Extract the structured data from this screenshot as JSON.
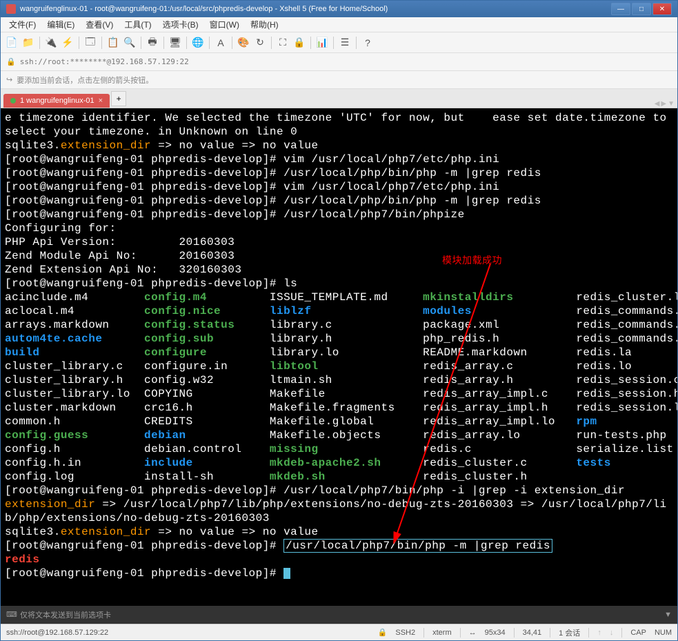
{
  "window_title": "wangruifenglinux-01 - root@wangruifeng-01:/usr/local/src/phpredis-develop - Xshell 5 (Free for Home/School)",
  "menu": {
    "file": "文件(F)",
    "edit": "编辑(E)",
    "view": "查看(V)",
    "tools": "工具(T)",
    "tabs": "选项卡(B)",
    "window": "窗口(W)",
    "help": "帮助(H)"
  },
  "addr": {
    "lock": "🔒",
    "text": "ssh://root:********@192.168.57.129:22"
  },
  "infobar_text": "要添加当前会话，点击左侧的箭头按钮。",
  "tab": {
    "label": "1 wangruifenglinux-01"
  },
  "annotation": "模块加载成功",
  "terminal": {
    "l1": "e timezone identifier. We selected the timezone 'UTC' for now, but    ease set date.timezone to",
    "l2": "select your timezone. in Unknown on line 0",
    "l3a": "sqlite3.",
    "l3b": "extension_dir",
    "l3c": " => no value => no value",
    "p1": "[root@wangruifeng-01 phpredis-develop]# ",
    "c1": "vim /usr/local/php7/etc/php.ini",
    "c2": "/usr/local/php/bin/php -m |grep redis",
    "c3": "vim /usr/local/php7/etc/php.ini",
    "c4": "/usr/local/php/bin/php -m |grep redis",
    "c5": "/usr/local/php7/bin/phpize",
    "cfg1": "Configuring for:",
    "cfg2": "PHP Api Version:         20160303",
    "cfg3": "Zend Module Api No:      20160303",
    "cfg4": "Zend Extension Api No:   320160303",
    "c6": "ls",
    "ls": [
      {
        "a": "acinclude.m4",
        "ac": "",
        "b": "config.m4",
        "bc": "green",
        "c": "ISSUE_TEMPLATE.md",
        "cc": "",
        "d": "mkinstalldirs",
        "dc": "green",
        "e": "redis_cluster.lo",
        "ec": ""
      },
      {
        "a": "aclocal.m4",
        "ac": "",
        "b": "config.nice",
        "bc": "green",
        "c": "liblzf",
        "cc": "blue",
        "d": "modules",
        "dc": "blue",
        "e": "redis_commands.c",
        "ec": ""
      },
      {
        "a": "arrays.markdown",
        "ac": "",
        "b": "config.status",
        "bc": "green",
        "c": "library.c",
        "cc": "",
        "d": "package.xml",
        "dc": "",
        "e": "redis_commands.h",
        "ec": ""
      },
      {
        "a": "autom4te.cache",
        "ac": "blue",
        "b": "config.sub",
        "bc": "green",
        "c": "library.h",
        "cc": "",
        "d": "php_redis.h",
        "dc": "",
        "e": "redis_commands.lo",
        "ec": ""
      },
      {
        "a": "build",
        "ac": "blue",
        "b": "configure",
        "bc": "green",
        "c": "library.lo",
        "cc": "",
        "d": "README.markdown",
        "dc": "",
        "e": "redis.la",
        "ec": ""
      },
      {
        "a": "cluster_library.c",
        "ac": "",
        "b": "configure.in",
        "bc": "",
        "c": "libtool",
        "cc": "green",
        "d": "redis_array.c",
        "dc": "",
        "e": "redis.lo",
        "ec": ""
      },
      {
        "a": "cluster_library.h",
        "ac": "",
        "b": "config.w32",
        "bc": "",
        "c": "ltmain.sh",
        "cc": "",
        "d": "redis_array.h",
        "dc": "",
        "e": "redis_session.c",
        "ec": ""
      },
      {
        "a": "cluster_library.lo",
        "ac": "",
        "b": "COPYING",
        "bc": "",
        "c": "Makefile",
        "cc": "",
        "d": "redis_array_impl.c",
        "dc": "",
        "e": "redis_session.h",
        "ec": ""
      },
      {
        "a": "cluster.markdown",
        "ac": "",
        "b": "crc16.h",
        "bc": "",
        "c": "Makefile.fragments",
        "cc": "",
        "d": "redis_array_impl.h",
        "dc": "",
        "e": "redis_session.lo",
        "ec": ""
      },
      {
        "a": "common.h",
        "ac": "",
        "b": "CREDITS",
        "bc": "",
        "c": "Makefile.global",
        "cc": "",
        "d": "redis_array_impl.lo",
        "dc": "",
        "e": "rpm",
        "ec": "blue"
      },
      {
        "a": "config.guess",
        "ac": "green",
        "b": "debian",
        "bc": "blue",
        "c": "Makefile.objects",
        "cc": "",
        "d": "redis_array.lo",
        "dc": "",
        "e": "run-tests.php",
        "ec": ""
      },
      {
        "a": "config.h",
        "ac": "",
        "b": "debian.control",
        "bc": "",
        "c": "missing",
        "cc": "green",
        "d": "redis.c",
        "dc": "",
        "e": "serialize.list",
        "ec": ""
      },
      {
        "a": "config.h.in",
        "ac": "",
        "b": "include",
        "bc": "blue",
        "c": "mkdeb-apache2.sh",
        "cc": "green",
        "d": "redis_cluster.c",
        "dc": "",
        "e": "tests",
        "ec": "blue"
      },
      {
        "a": "config.log",
        "ac": "",
        "b": "install-sh",
        "bc": "",
        "c": "mkdeb.sh",
        "cc": "green",
        "d": "redis_cluster.h",
        "dc": "",
        "e": "",
        "ec": ""
      }
    ],
    "c7": "/usr/local/php7/bin/php -i |grep -i extension_dir",
    "ext1a": "extension_dir",
    "ext1b": " => /usr/local/php7/lib/php/extensions/no-debug-zts-20160303 => /usr/local/php7/li",
    "ext2": "b/php/extensions/no-debug-zts-20160303",
    "c8": "/usr/local/php7/bin/php -m |grep redis",
    "result": "redis"
  },
  "sendbar_text": "仅将文本发送到当前选项卡",
  "status": {
    "conn": "ssh://root@192.168.57.129:22",
    "proto": "SSH2",
    "term": "xterm",
    "size": "95x34",
    "pos": "34,41",
    "sess": "1 会话",
    "cap": "CAP",
    "num": "NUM"
  }
}
